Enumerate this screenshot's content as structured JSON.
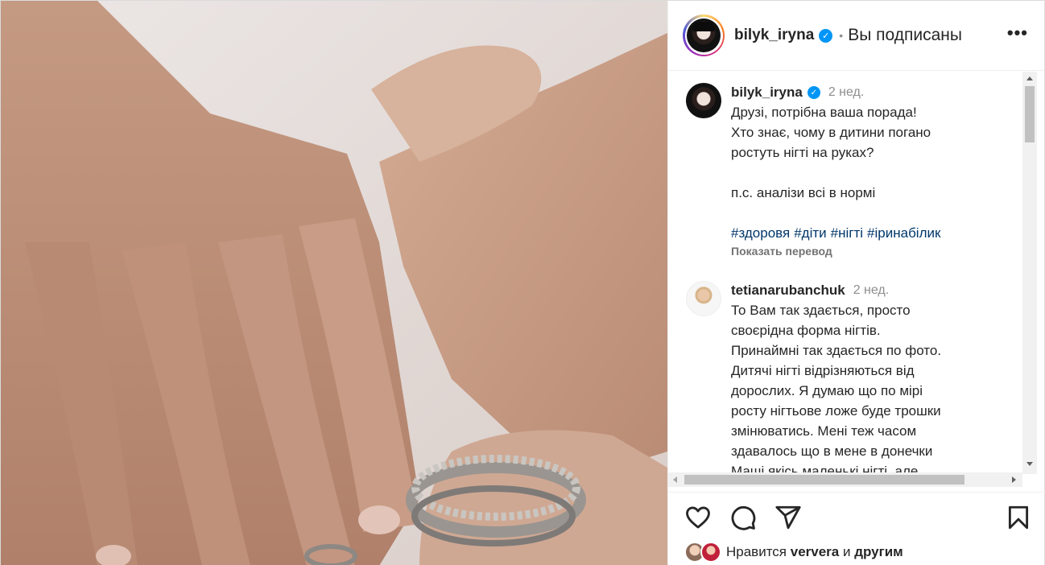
{
  "post_image": {
    "icon": "hands-with-rings-photo"
  },
  "header": {
    "username": "bilyk_iryna",
    "verified_icon": "verified-badge-icon",
    "separator": "•",
    "follow_status": "Вы подписаны",
    "more_icon": "more-options-icon",
    "more_glyph": "•••"
  },
  "caption": {
    "username": "bilyk_iryna",
    "time": "2 нед.",
    "lines": [
      "Друзі, потрібна ваша порада!",
      "Хто знає, чому в дитини погано",
      "ростуть нігті на руках?",
      "",
      "п.с. аналізи всі в нормі",
      ""
    ],
    "hashtags": [
      "#здоровя",
      "#діти",
      "#нігті",
      "#іринабілик"
    ],
    "translate_label": "Показать перевод"
  },
  "comment": {
    "username": "tetianarubanchuk",
    "time": "2 нед.",
    "lines": [
      "То Вам так здається, просто",
      "своєрідна форма нігтів.",
      "Принаймні так здається по фото.",
      "Дитячі нігті відрізняються від",
      "дорослих. Я думаю що по мірі",
      "росту нігтьове ложе буде трошки",
      "змінюватись. Мені теж часом",
      "здавалось що в мене в донечки",
      "Маші якісь маленькі нігті, але"
    ]
  },
  "actions": {
    "like_icon": "heart-icon",
    "comment_icon": "comment-icon",
    "share_icon": "share-icon",
    "save_icon": "bookmark-icon"
  },
  "likes": {
    "prefix": "Нравится",
    "user": "ververa",
    "conjunction": "и",
    "others": "другим"
  },
  "colors": {
    "link": "#00376b",
    "verified": "#0095f6",
    "muted": "#8e8e8e",
    "text": "#262626"
  }
}
